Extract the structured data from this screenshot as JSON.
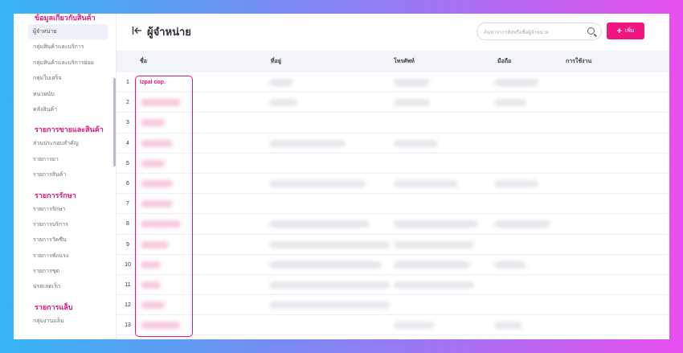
{
  "sidebar": {
    "sections": [
      {
        "title": "ข้อมูลเกี่ยวกับสินค้า",
        "items": [
          {
            "label": "ผู้จำหน่าย",
            "active": true
          },
          {
            "label": "กลุ่มสินค้าและบริการ"
          },
          {
            "label": "กลุ่มสินค้าและบริการย่อย"
          },
          {
            "label": "กลุ่มใบเสร็จ"
          },
          {
            "label": "หน่วยนับ"
          },
          {
            "label": "คลังสินค้า"
          }
        ]
      },
      {
        "title": "รายการขายและสินค้า",
        "items": [
          {
            "label": "ส่วนประกอบสำคัญ"
          },
          {
            "label": "รายการยา"
          },
          {
            "label": "รายการสินค้า"
          }
        ]
      },
      {
        "title": "รายการรักษา",
        "items": [
          {
            "label": "รายการรักษา"
          },
          {
            "label": "รายการบริการ"
          },
          {
            "label": "รายการวัคซีน"
          },
          {
            "label": "รายการพักแรง"
          },
          {
            "label": "รายการชุด"
          },
          {
            "label": "ปรสเลตเร็ก"
          }
        ]
      },
      {
        "title": "รายการแล็บ",
        "items": [
          {
            "label": "กลุ่มงานแล็บ"
          }
        ]
      }
    ]
  },
  "header": {
    "title": "ผู้จำหน่าย",
    "search_placeholder": "ค้นหาจากรหัสหรือชื่อผู้จำหน่าย",
    "add_label": "เพิ่ม"
  },
  "table": {
    "columns": [
      "ชื่อ",
      "ที่อยู่",
      "โทรศัพท์",
      "มือถือ",
      "การใช้งาน"
    ],
    "rows": [
      {
        "num": "1",
        "name": "Izpal cop."
      },
      {
        "num": "2",
        "name": ""
      },
      {
        "num": "3",
        "name": ""
      },
      {
        "num": "4",
        "name": ""
      },
      {
        "num": "5",
        "name": ""
      },
      {
        "num": "6",
        "name": ""
      },
      {
        "num": "7",
        "name": ""
      },
      {
        "num": "8",
        "name": ""
      },
      {
        "num": "9",
        "name": ""
      },
      {
        "num": "10",
        "name": ""
      },
      {
        "num": "11",
        "name": ""
      },
      {
        "num": "12",
        "name": ""
      },
      {
        "num": "13",
        "name": ""
      }
    ]
  },
  "colors": {
    "accent": "#e2187d",
    "button": "#f0157f",
    "gradient_left": "#35b6f5",
    "gradient_right": "#e84ff0"
  }
}
